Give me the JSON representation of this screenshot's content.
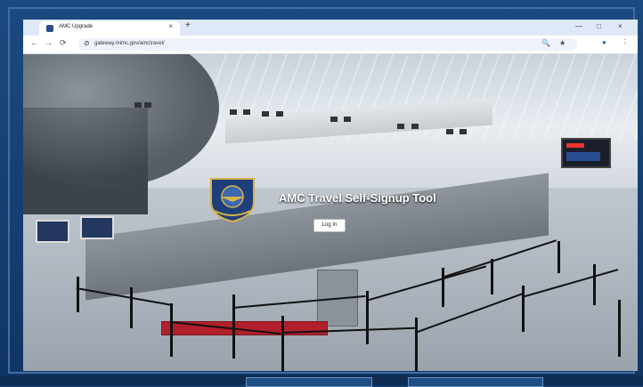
{
  "browser": {
    "tab_title": "AMC Upgrade",
    "tab_close": "×",
    "new_tab": "+",
    "window_controls": {
      "minimize": "—",
      "maximize": "□",
      "close": "×"
    },
    "back": "←",
    "forward": "→",
    "reload": "⟳",
    "url": "gateway.mimc.gov/amctravel/",
    "site_info_icon": "⊘",
    "search_icon": "🔍",
    "bookmark_icon": "★",
    "profile_icon": "●",
    "menu_icon": "⋮"
  },
  "hero": {
    "title": "AMC Travel Self-Signup Tool",
    "login_label": "Log In"
  },
  "colors": {
    "frame": "#1b4a80",
    "accent": "#2a4e87",
    "mat": "#b1202a"
  }
}
